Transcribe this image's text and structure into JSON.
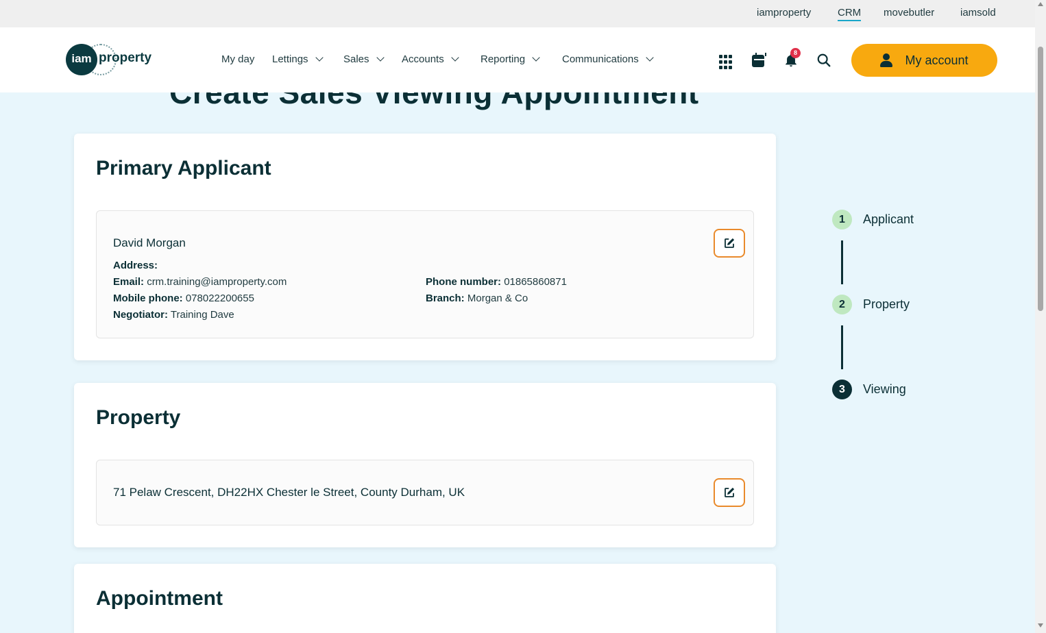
{
  "topbar": {
    "links": [
      {
        "label": "iamproperty",
        "active": false
      },
      {
        "label": "CRM",
        "active": true
      },
      {
        "label": "movebutler",
        "active": false
      },
      {
        "label": "iamsold",
        "active": false
      }
    ]
  },
  "header": {
    "logo_text_circle": "iam",
    "logo_text_word": "property",
    "nav": [
      {
        "label": "My day",
        "dropdown": false
      },
      {
        "label": "Lettings",
        "dropdown": true
      },
      {
        "label": "Sales",
        "dropdown": true
      },
      {
        "label": "Accounts",
        "dropdown": true
      },
      {
        "label": "Reporting",
        "dropdown": true
      },
      {
        "label": "Communications",
        "dropdown": true
      }
    ],
    "notification_count": "8",
    "account_label": "My account",
    "icons": [
      "apps-grid-icon",
      "calendar-icon",
      "bell-icon",
      "search-icon",
      "user-icon"
    ]
  },
  "page": {
    "title": "Create Sales Viewing Appointment"
  },
  "primary_applicant": {
    "heading": "Primary Applicant",
    "name": "David Morgan",
    "address_label": "Address:",
    "email_label": "Email:",
    "email": "crm.training@iamproperty.com",
    "mobile_label": "Mobile phone:",
    "mobile": "078022200655",
    "negotiator_label": "Negotiator:",
    "negotiator": "Training Dave",
    "phone_label": "Phone number:",
    "phone": "01865860871",
    "branch_label": "Branch:",
    "branch": "Morgan & Co"
  },
  "property": {
    "heading": "Property",
    "address": "71 Pelaw Crescent, DH22HX Chester le Street, County Durham, UK"
  },
  "appointment": {
    "heading": "Appointment"
  },
  "steps": [
    {
      "number": "1",
      "label": "Applicant",
      "state": "complete"
    },
    {
      "number": "2",
      "label": "Property",
      "state": "complete"
    },
    {
      "number": "3",
      "label": "Viewing",
      "state": "current"
    }
  ],
  "colors": {
    "accent": "#f8a90f",
    "edit_border": "#e98a2b",
    "dark": "#0b2f35",
    "background": "#e8f6fc",
    "step_complete": "#bfe8c0",
    "badge": "#e0304a"
  }
}
